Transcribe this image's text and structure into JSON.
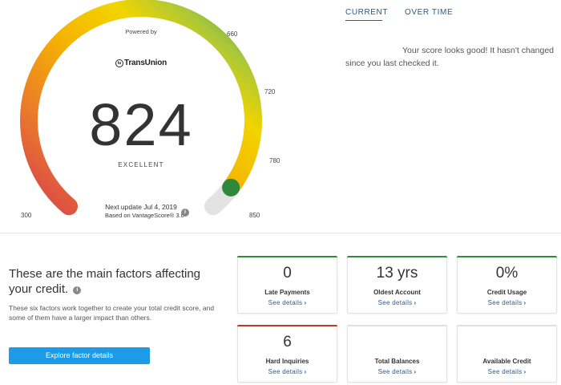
{
  "gauge": {
    "powered_by": "Powered by",
    "provider": "TransUnion",
    "provider_mark": "tu",
    "score": "824",
    "rating": "EXCELLENT",
    "next_update": "Next update Jul 4, 2019",
    "based_on": "Based on VantageScore® 3.0",
    "info_glyph": "i",
    "score_value": 824,
    "min": 300,
    "max": 850,
    "ticks": {
      "t300": "300",
      "t660": "660",
      "t720": "720",
      "t780": "780",
      "t850": "850"
    }
  },
  "tabs": [
    {
      "label": "CURRENT",
      "active": true
    },
    {
      "label": "OVER TIME",
      "active": false
    }
  ],
  "message": {
    "line1": "Your score looks good! It hasn't changed",
    "line2": "since you last checked it."
  },
  "factors": {
    "title": "These are the main factors affecting your credit.",
    "info_glyph": "i",
    "description": "These six factors work together to create your total credit score, and some of them have a larger impact than others.",
    "button_label": "Explore factor details"
  },
  "cards": [
    {
      "value": "0",
      "label": "Late Payments",
      "link": "See details",
      "chevron": "›",
      "status_color": "#2e8b3e"
    },
    {
      "value": "13 yrs",
      "label": "Oldest Account",
      "link": "See details",
      "chevron": "›",
      "status_color": "#2e8b3e"
    },
    {
      "value": "0%",
      "label": "Credit Usage",
      "link": "See details",
      "chevron": "›",
      "status_color": "#2e8b3e"
    },
    {
      "value": "6",
      "label": "Hard Inquiries",
      "link": "See details",
      "chevron": "›",
      "status_color": "#c0392b"
    },
    {
      "value": "",
      "label": "Total Balances",
      "link": "See details",
      "chevron": "›",
      "status_color": "#e0e0e0"
    },
    {
      "value": "",
      "label": "Available Credit",
      "link": "See details",
      "chevron": "›",
      "status_color": "#e0e0e0"
    }
  ],
  "colors": {
    "accent": "#1e9be8",
    "link": "#2b5a8a",
    "gauge_track": "#e3e3e3",
    "gauge_gradient": [
      "#d9414c",
      "#ea7d2a",
      "#f5b400",
      "#f2d400",
      "#a8c73a",
      "#2e9a3e"
    ],
    "indicator": "#2e9a3e"
  }
}
